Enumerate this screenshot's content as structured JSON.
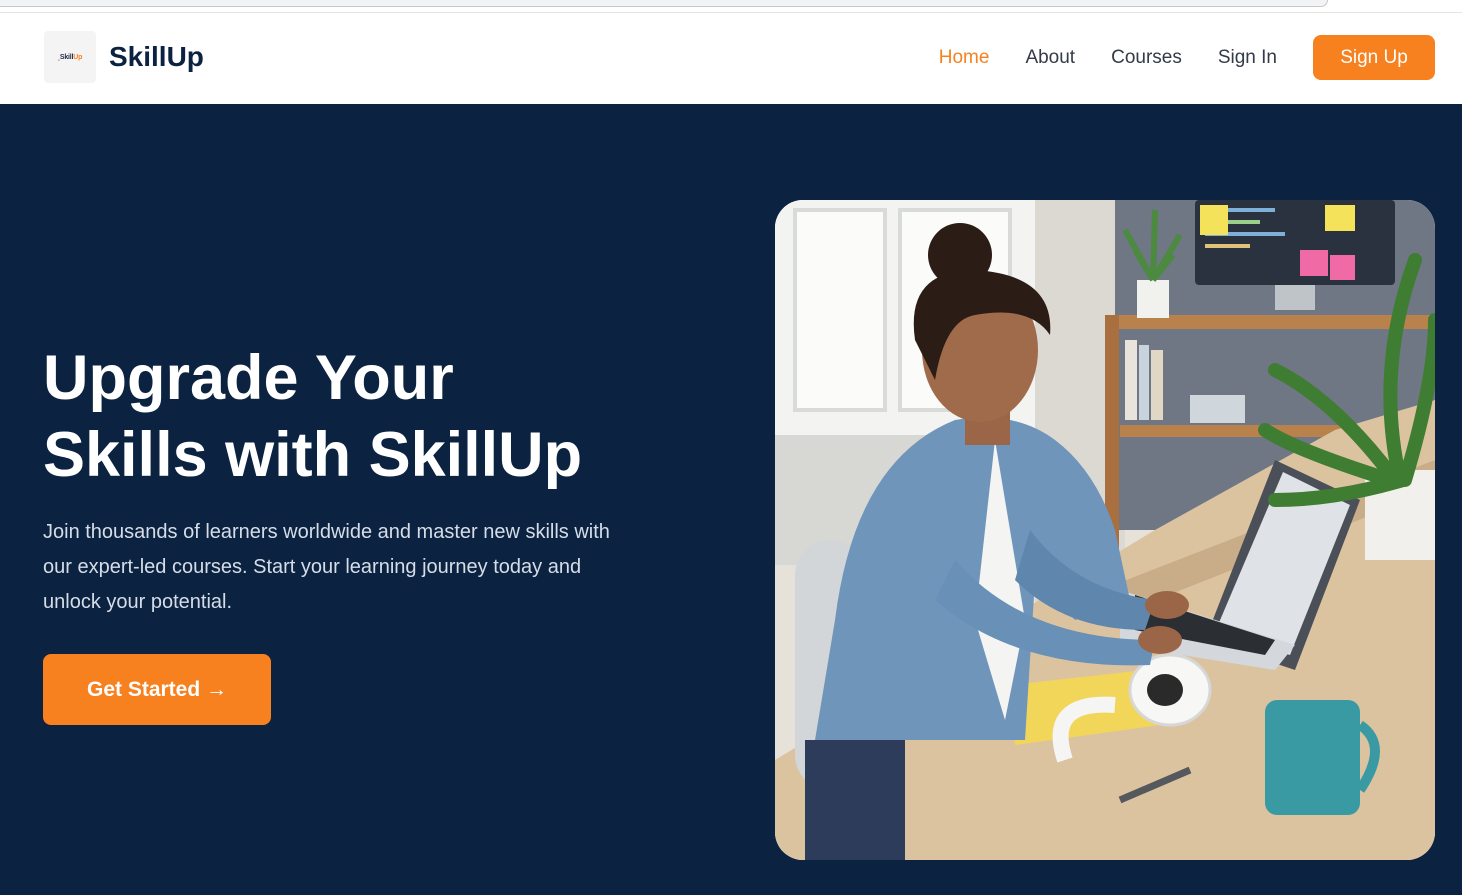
{
  "brand": {
    "logo_text_skill": "Skill",
    "logo_text_up": "Up",
    "name": "SkillUp"
  },
  "nav": {
    "items": [
      {
        "label": "Home",
        "active": true
      },
      {
        "label": "About",
        "active": false
      },
      {
        "label": "Courses",
        "active": false
      },
      {
        "label": "Sign In",
        "active": false
      }
    ],
    "signup_label": "Sign Up"
  },
  "hero": {
    "title_line1": "Upgrade Your",
    "title_line2": "Skills with SkillUp",
    "description": "Join thousands of learners worldwide and master new skills with our expert-led courses. Start your learning journey today and unlock your potential.",
    "cta_label": "Get Started →",
    "image_subject": "woman typing on laptop at desk"
  },
  "colors": {
    "accent": "#f7801f",
    "navy": "#0b2340",
    "brand_text": "#0b2240"
  }
}
